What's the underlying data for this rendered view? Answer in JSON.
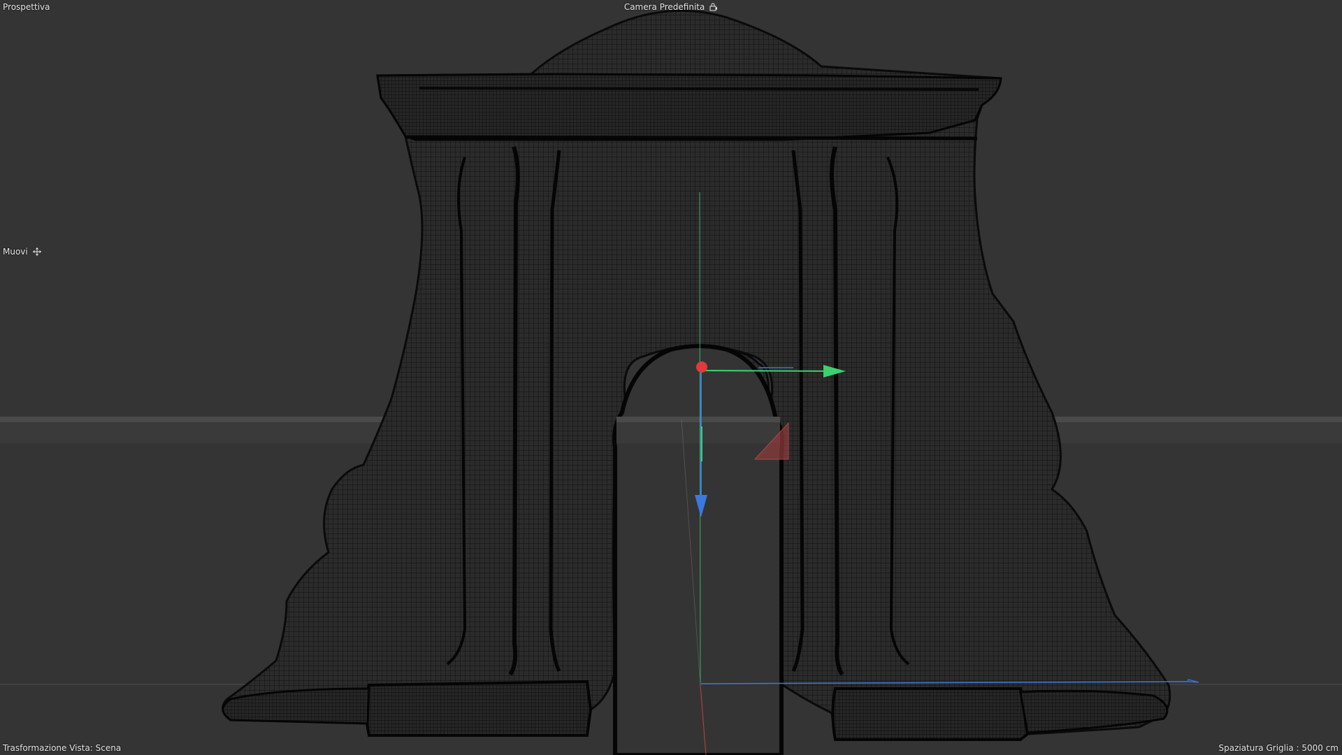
{
  "viewport": {
    "view_name": "Prospettiva",
    "camera_name": "Camera Predefinita",
    "camera_icon": "camera-lock-icon",
    "active_tool": "Muovi",
    "tool_icon": "move-cross-icon",
    "transform_mode": "Trasformazione Vista: Scena",
    "grid_spacing": "Spaziatura Griglia : 5000 cm"
  },
  "colors": {
    "background": "#343434",
    "mesh_fill": "#2a2a2a",
    "mesh_wire": "#0d0d0d",
    "axis_x": "#e04848",
    "axis_y": "#3cd070",
    "axis_z": "#3a7ae0",
    "text": "#e8e8e8"
  }
}
